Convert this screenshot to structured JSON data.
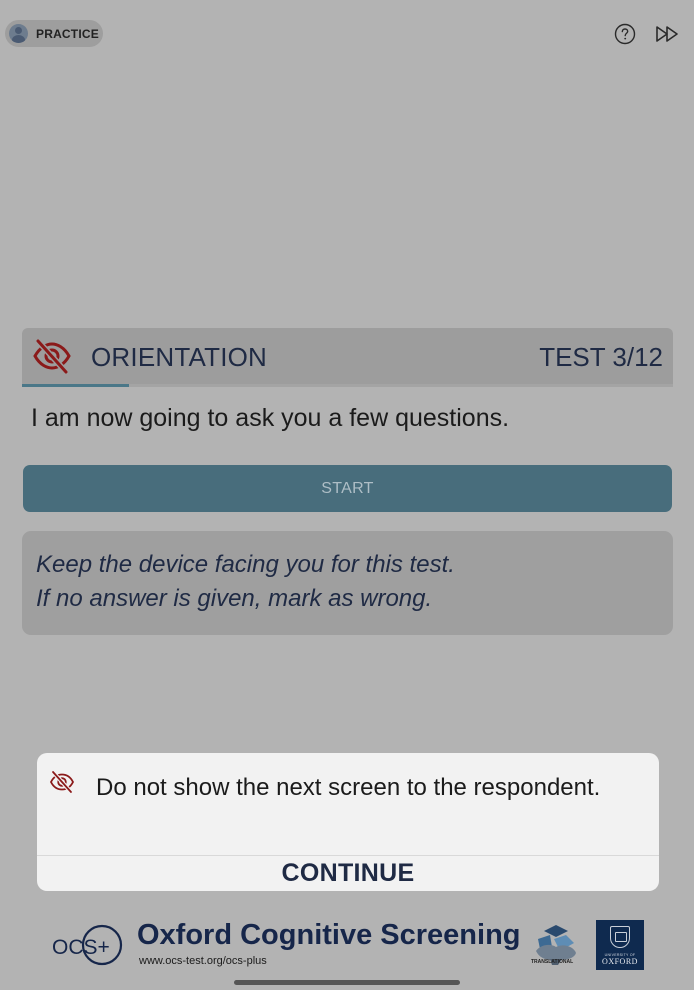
{
  "top_bar": {
    "practice_label": "PRACTICE",
    "help_icon": "question-circle-icon",
    "skip_icon": "fast-forward-icon"
  },
  "test_header": {
    "icon": "eye-slash-icon",
    "title": "ORIENTATION",
    "counter": "TEST 3/12",
    "progress_fraction": 0.165
  },
  "instruction": "I am now going to ask you a few questions.",
  "start_button": {
    "label": "START"
  },
  "note": {
    "lines": [
      "Keep the device facing you for this test.",
      "If no answer is given, mark as wrong."
    ]
  },
  "dialog": {
    "icon": "eye-slash-icon",
    "message": "Do not show the next screen to the respondent.",
    "continue_label": "CONTINUE"
  },
  "footer": {
    "logo_text": "OCS+",
    "title": "Oxford Cognitive Screening",
    "url": "www.ocs-test.org/ocs-plus",
    "translational_label": "TRANSLATIONAL",
    "oxford_small": "UNIVERSITY OF",
    "oxford_big": "OXFORD"
  },
  "colors": {
    "overlay_background": "#b3b3b3",
    "accent_red": "#8b1a1a",
    "navy": "#1f2a44",
    "start_button": "#486d7c"
  }
}
